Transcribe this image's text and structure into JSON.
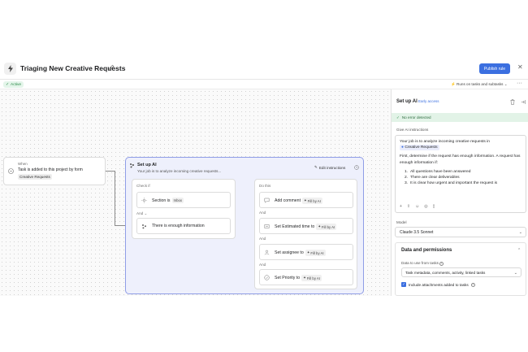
{
  "header": {
    "title": "Triaging New Creative Requests",
    "publish_label": "Publish rule"
  },
  "subbar": {
    "status": "Active",
    "runs_on": "Runs on tasks and subtasks"
  },
  "trigger": {
    "label": "When",
    "text": "Task is added to this project by form",
    "tag": "Creative Requests"
  },
  "ai_block": {
    "title": "Set up AI",
    "subtitle": "Your job is to analyze incoming creative requests...",
    "edit_label": "Edit instructions",
    "check": {
      "label": "Check if",
      "rows": [
        {
          "text": "Section is",
          "chip": "Inbox"
        },
        {
          "text": "There is enough information"
        }
      ],
      "and_label": "And"
    },
    "do": {
      "label": "Do this",
      "and_label": "And",
      "rows": [
        {
          "text": "Add comment",
          "chip": "Fill by AI"
        },
        {
          "text": "Set Estimated time to",
          "chip": "Fill by AI"
        },
        {
          "text": "Set assignee to",
          "chip": "Fill by AI"
        },
        {
          "text": "Set Priority to",
          "chip": "Fill by AI"
        }
      ]
    }
  },
  "panel": {
    "title": "Set up AI",
    "badge": "Early access",
    "no_error": "No error detected",
    "instructions_label": "Give AI instructions",
    "instructions": {
      "line1_prefix": "Your job is to analyze incoming creative requests in",
      "line1_tag": "Creative Requests",
      "para2": "First, determine if the request has enough information. A request has enough information if:",
      "list": [
        {
          "num": "1.",
          "text": "All questions have been answered"
        },
        {
          "num": "2.",
          "text": "There are clear deliverables"
        },
        {
          "num": "3.",
          "text": "It is clear how urgent and important the request is"
        }
      ]
    },
    "model_label": "Model",
    "model_value": "Claude 3.5 Sonnet",
    "data_permissions_title": "Data and permissions",
    "data_use_label": "Data to use from tasks",
    "data_use_value": "Task metadata, comments, activity, linked tasks",
    "include_attachments": "Include attachments added to tasks"
  },
  "colors": {
    "accent": "#3b6fe0",
    "ai_frame_border": "#8f9de6",
    "ai_frame_bg": "#eef0fc",
    "success_bg": "#e2f3e7"
  }
}
